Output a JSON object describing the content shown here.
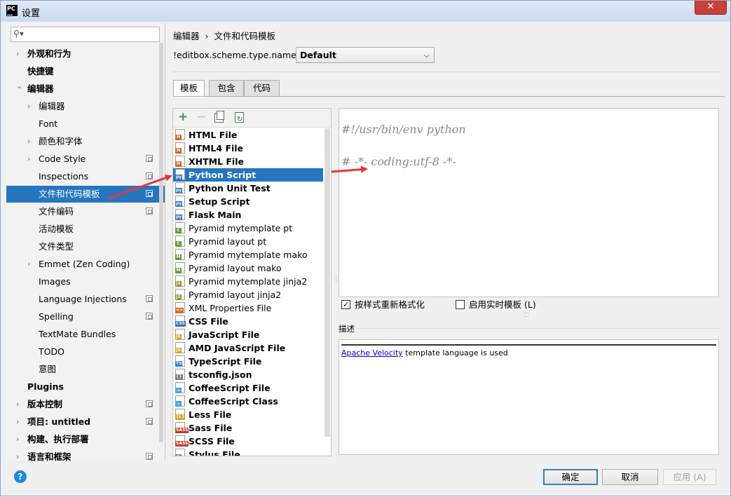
{
  "window": {
    "title": "设置",
    "app_icon": "PC",
    "close_symbol": "✕"
  },
  "search": {
    "placeholder": "",
    "value": ""
  },
  "sidebar": {
    "items": [
      {
        "label": "外观和行为",
        "bold": true,
        "chevron": "right",
        "level": 0
      },
      {
        "label": "快捷键",
        "bold": true,
        "chevron": "none",
        "level": 0
      },
      {
        "label": "编辑器",
        "bold": true,
        "chevron": "down",
        "level": 0
      },
      {
        "label": "编辑器",
        "bold": false,
        "chevron": "right",
        "level": 1
      },
      {
        "label": "Font",
        "bold": false,
        "chevron": "none",
        "level": 1
      },
      {
        "label": "颜色和字体",
        "bold": false,
        "chevron": "right",
        "level": 1
      },
      {
        "label": "Code Style",
        "bold": false,
        "chevron": "right",
        "level": 1,
        "project_icon": true
      },
      {
        "label": "Inspections",
        "bold": false,
        "chevron": "none",
        "level": 1,
        "project_icon": true
      },
      {
        "label": "文件和代码模板",
        "bold": false,
        "chevron": "none",
        "level": 1,
        "project_icon": true,
        "selected": true
      },
      {
        "label": "文件编码",
        "bold": false,
        "chevron": "none",
        "level": 1,
        "project_icon": true
      },
      {
        "label": "活动模板",
        "bold": false,
        "chevron": "none",
        "level": 1
      },
      {
        "label": "文件类型",
        "bold": false,
        "chevron": "none",
        "level": 1
      },
      {
        "label": "Emmet (Zen Coding)",
        "bold": false,
        "chevron": "right",
        "level": 1
      },
      {
        "label": "Images",
        "bold": false,
        "chevron": "none",
        "level": 1
      },
      {
        "label": "Language Injections",
        "bold": false,
        "chevron": "none",
        "level": 1,
        "project_icon": true
      },
      {
        "label": "Spelling",
        "bold": false,
        "chevron": "none",
        "level": 1,
        "project_icon": true
      },
      {
        "label": "TextMate Bundles",
        "bold": false,
        "chevron": "none",
        "level": 1
      },
      {
        "label": "TODO",
        "bold": false,
        "chevron": "none",
        "level": 1
      },
      {
        "label": "意图",
        "bold": false,
        "chevron": "none",
        "level": 1
      },
      {
        "label": "Plugins",
        "bold": true,
        "chevron": "none",
        "level": 0
      },
      {
        "label": "版本控制",
        "bold": true,
        "chevron": "right",
        "level": 0,
        "project_icon": true
      },
      {
        "label": "项目: untitled",
        "bold": true,
        "chevron": "right",
        "level": 0,
        "project_icon": true
      },
      {
        "label": "构建、执行部署",
        "bold": true,
        "chevron": "right",
        "level": 0
      },
      {
        "label": "语言和框架",
        "bold": true,
        "chevron": "right",
        "level": 0,
        "project_icon": true
      }
    ]
  },
  "breadcrumb": {
    "part1": "编辑器",
    "separator": "›",
    "part2": "文件和代码模板"
  },
  "scheme": {
    "label": "!editbox.scheme.type.name!:",
    "value": "Default",
    "arrow": "⌵"
  },
  "tabs": [
    {
      "label": "模板",
      "active": true
    },
    {
      "label": "包含",
      "active": false
    },
    {
      "label": "代码",
      "active": false
    }
  ],
  "toolbar": {
    "add": "+",
    "remove": "−"
  },
  "templates": [
    {
      "name": "HTML File",
      "bold": true,
      "badge": "H",
      "badge_color": "#d9662a"
    },
    {
      "name": "HTML4 File",
      "bold": true,
      "badge": "H",
      "badge_color": "#d9662a"
    },
    {
      "name": "XHTML File",
      "bold": true,
      "badge": "H",
      "badge_color": "#d9662a"
    },
    {
      "name": "Python Script",
      "bold": true,
      "badge": "py",
      "badge_color": "#3a75b0",
      "selected": true
    },
    {
      "name": "Python Unit Test",
      "bold": true,
      "badge": "py",
      "badge_color": "#3a75b0"
    },
    {
      "name": "Setup Script",
      "bold": true,
      "badge": "py",
      "badge_color": "#3a75b0"
    },
    {
      "name": "Flask Main",
      "bold": true,
      "badge": "py",
      "badge_color": "#3a75b0"
    },
    {
      "name": "Pyramid mytemplate pt",
      "bold": false,
      "badge": "C",
      "badge_color": "#5b9a3e"
    },
    {
      "name": "Pyramid layout pt",
      "bold": false,
      "badge": "C",
      "badge_color": "#5b9a3e"
    },
    {
      "name": "Pyramid mytemplate mako",
      "bold": false,
      "badge": "M",
      "badge_color": "#5b9a3e"
    },
    {
      "name": "Pyramid layout mako",
      "bold": false,
      "badge": "M",
      "badge_color": "#5b9a3e"
    },
    {
      "name": "Pyramid mytemplate jinja2",
      "bold": false,
      "badge": "J2",
      "badge_color": "#8a8f2a"
    },
    {
      "name": "Pyramid layout jinja2",
      "bold": false,
      "badge": "J2",
      "badge_color": "#8a8f2a"
    },
    {
      "name": "XML Properties File",
      "bold": false,
      "badge": "<>",
      "badge_color": "#d9662a"
    },
    {
      "name": "CSS File",
      "bold": true,
      "badge": "CSS",
      "badge_color": "#2f6fb3"
    },
    {
      "name": "JavaScript File",
      "bold": true,
      "badge": "JS",
      "badge_color": "#c9a227"
    },
    {
      "name": "AMD JavaScript File",
      "bold": true,
      "badge": "JS",
      "badge_color": "#c9a227"
    },
    {
      "name": "TypeScript File",
      "bold": true,
      "badge": "TS",
      "badge_color": "#2f7fc1"
    },
    {
      "name": "tsconfig.json",
      "bold": true,
      "badge": "{}",
      "badge_color": "#777777"
    },
    {
      "name": "CoffeeScript File",
      "bold": true,
      "badge": "☕",
      "badge_color": "#4aa3d9"
    },
    {
      "name": "CoffeeScript Class",
      "bold": true,
      "badge": "☕",
      "badge_color": "#4aa3d9"
    },
    {
      "name": "Less File",
      "bold": true,
      "badge": "{L}",
      "badge_color": "#c9a227"
    },
    {
      "name": "Sass File",
      "bold": true,
      "badge": "SASS",
      "badge_color": "#c0392b"
    },
    {
      "name": "SCSS File",
      "bold": true,
      "badge": "SASS",
      "badge_color": "#c0392b"
    },
    {
      "name": "Stylus File",
      "bold": true,
      "badge": "S",
      "badge_color": "#777777"
    }
  ],
  "editor": {
    "line1": "#!/usr/bin/env python",
    "line2": "# -*- coding:utf-8 -*-"
  },
  "options": {
    "reformat_label": "按样式重新格式化",
    "reformat_checked": "✓",
    "live_template_label": "启用实时模板 (L)"
  },
  "description": {
    "label": "描述",
    "link": "Apache Velocity",
    "text": " template language is used"
  },
  "buttons": {
    "help": "?",
    "ok": "确定",
    "cancel": "取消",
    "apply": "应用 (A)"
  },
  "colors": {
    "selection": "#2675bf",
    "annotation_arrow": "#e53935"
  }
}
